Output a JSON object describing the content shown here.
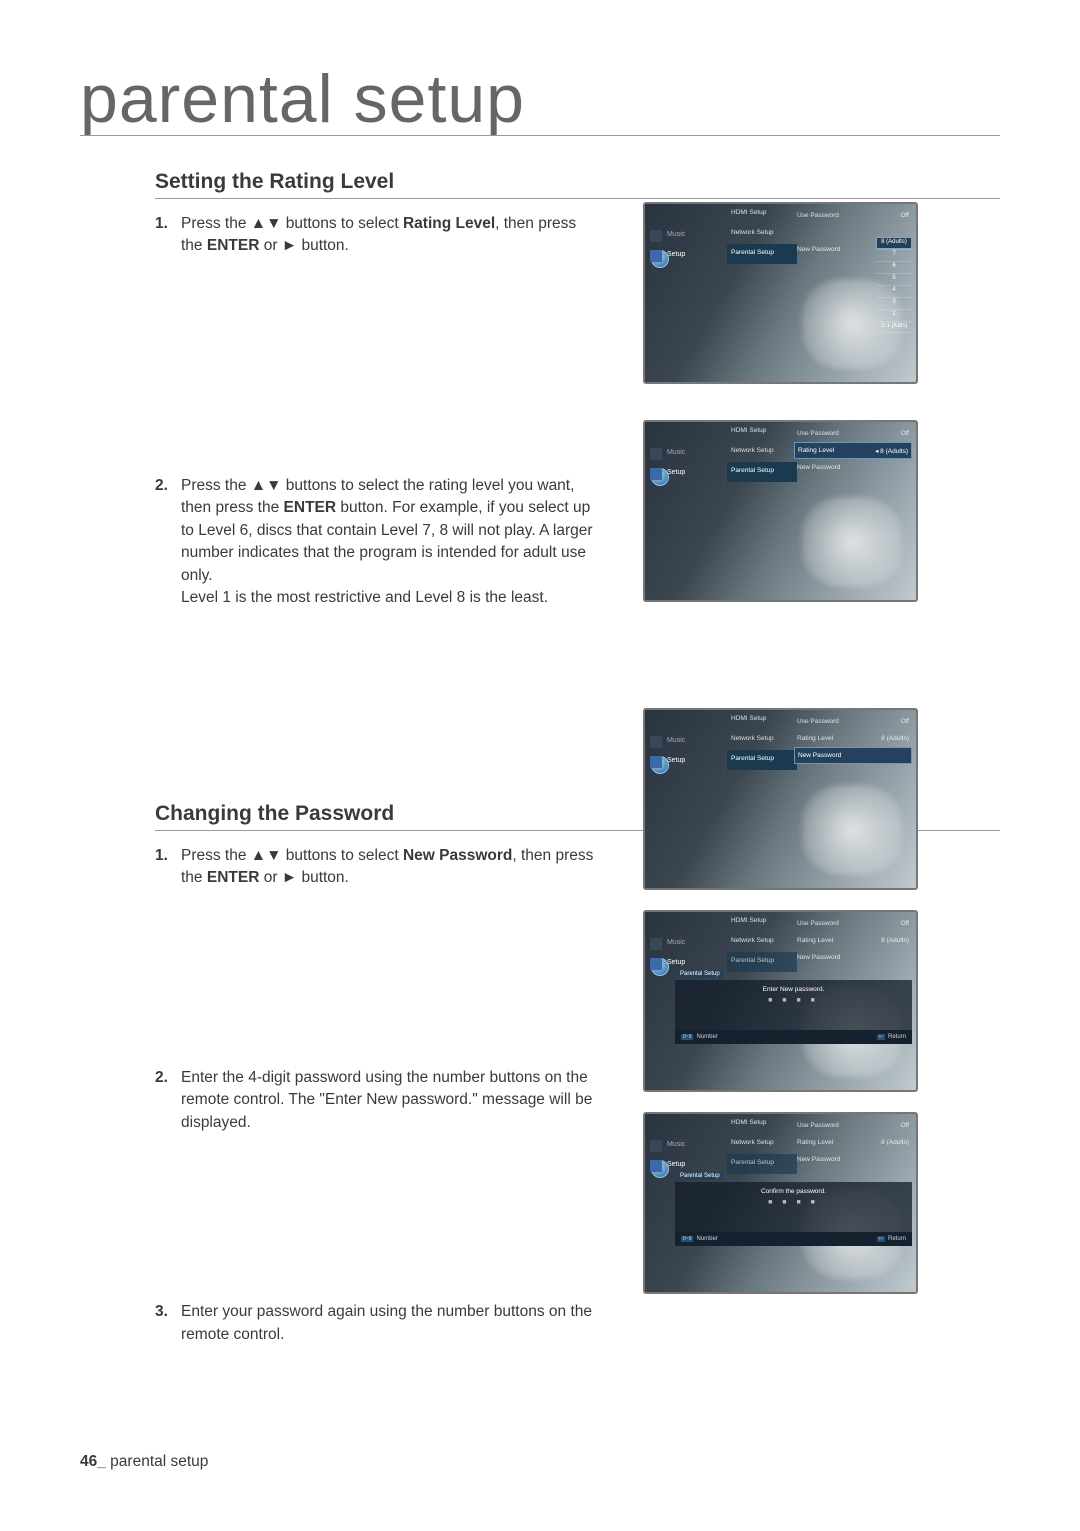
{
  "page": {
    "title": "parental setup",
    "footer_page": "46_",
    "footer_label": " parental setup"
  },
  "section1": {
    "heading": "Setting the Rating Level",
    "step1": {
      "num": "1.",
      "pre": "Press the ",
      "btn": "▲▼",
      "mid": " buttons to select ",
      "bold": "Rating Level",
      "after": ", then press the ",
      "bold2": "ENTER",
      "tail": " or ► button."
    },
    "step2": {
      "num": "2.",
      "pre": "Press the ",
      "btn": "▲▼",
      "mid": " buttons to select the rating level you want, then press the ",
      "bold": "ENTER",
      "after": " button. For example, if you select up to Level 6, discs that contain Level 7, 8 will not play. A larger number indicates that the program is intended for adult use only.",
      "line2": "Level 1 is the most restrictive and Level 8 is the least."
    }
  },
  "section2": {
    "heading": "Changing the Password",
    "step1": {
      "num": "1.",
      "pre": "Press the ",
      "btn": "▲▼",
      "mid": " buttons to select ",
      "bold": "New Password",
      "after": ", then press the ",
      "bold2": "ENTER",
      "tail": " or ► button."
    },
    "step2": {
      "num": "2.",
      "text": "Enter the 4-digit password using the number buttons on the remote control. The \"Enter New password.\" message will be displayed."
    },
    "step3": {
      "num": "3.",
      "text": "Enter your password again using the number buttons on the remote control."
    }
  },
  "osd": {
    "tab_music": "Music",
    "tab_setup": "Setup",
    "menu_hdmi": "HDMI Setup",
    "menu_network": "Network Setup",
    "menu_parental": "Parental Setup",
    "right_use_password": "Use Password",
    "right_use_password_val": "Off",
    "right_rating_level": "Rating Level",
    "right_rating_val": "8 (Adults)",
    "right_new_password": "New Password",
    "drop_top": "8 (Adults)",
    "drop_7": "7",
    "drop_6": "6",
    "drop_5": "5",
    "drop_4": "4",
    "drop_3": "3",
    "drop_2": "2",
    "drop_bottom": "1 (Kids)",
    "modal_enter": "Enter New password.",
    "modal_confirm": "Confirm the password.",
    "modal_dots": "■ ■ ■ ■",
    "hint_number": "Number",
    "hint_return": "Return",
    "hint_tag_num": "0~9",
    "hint_tag_ret": "↩",
    "parental_crumb": "Parental Setup"
  }
}
